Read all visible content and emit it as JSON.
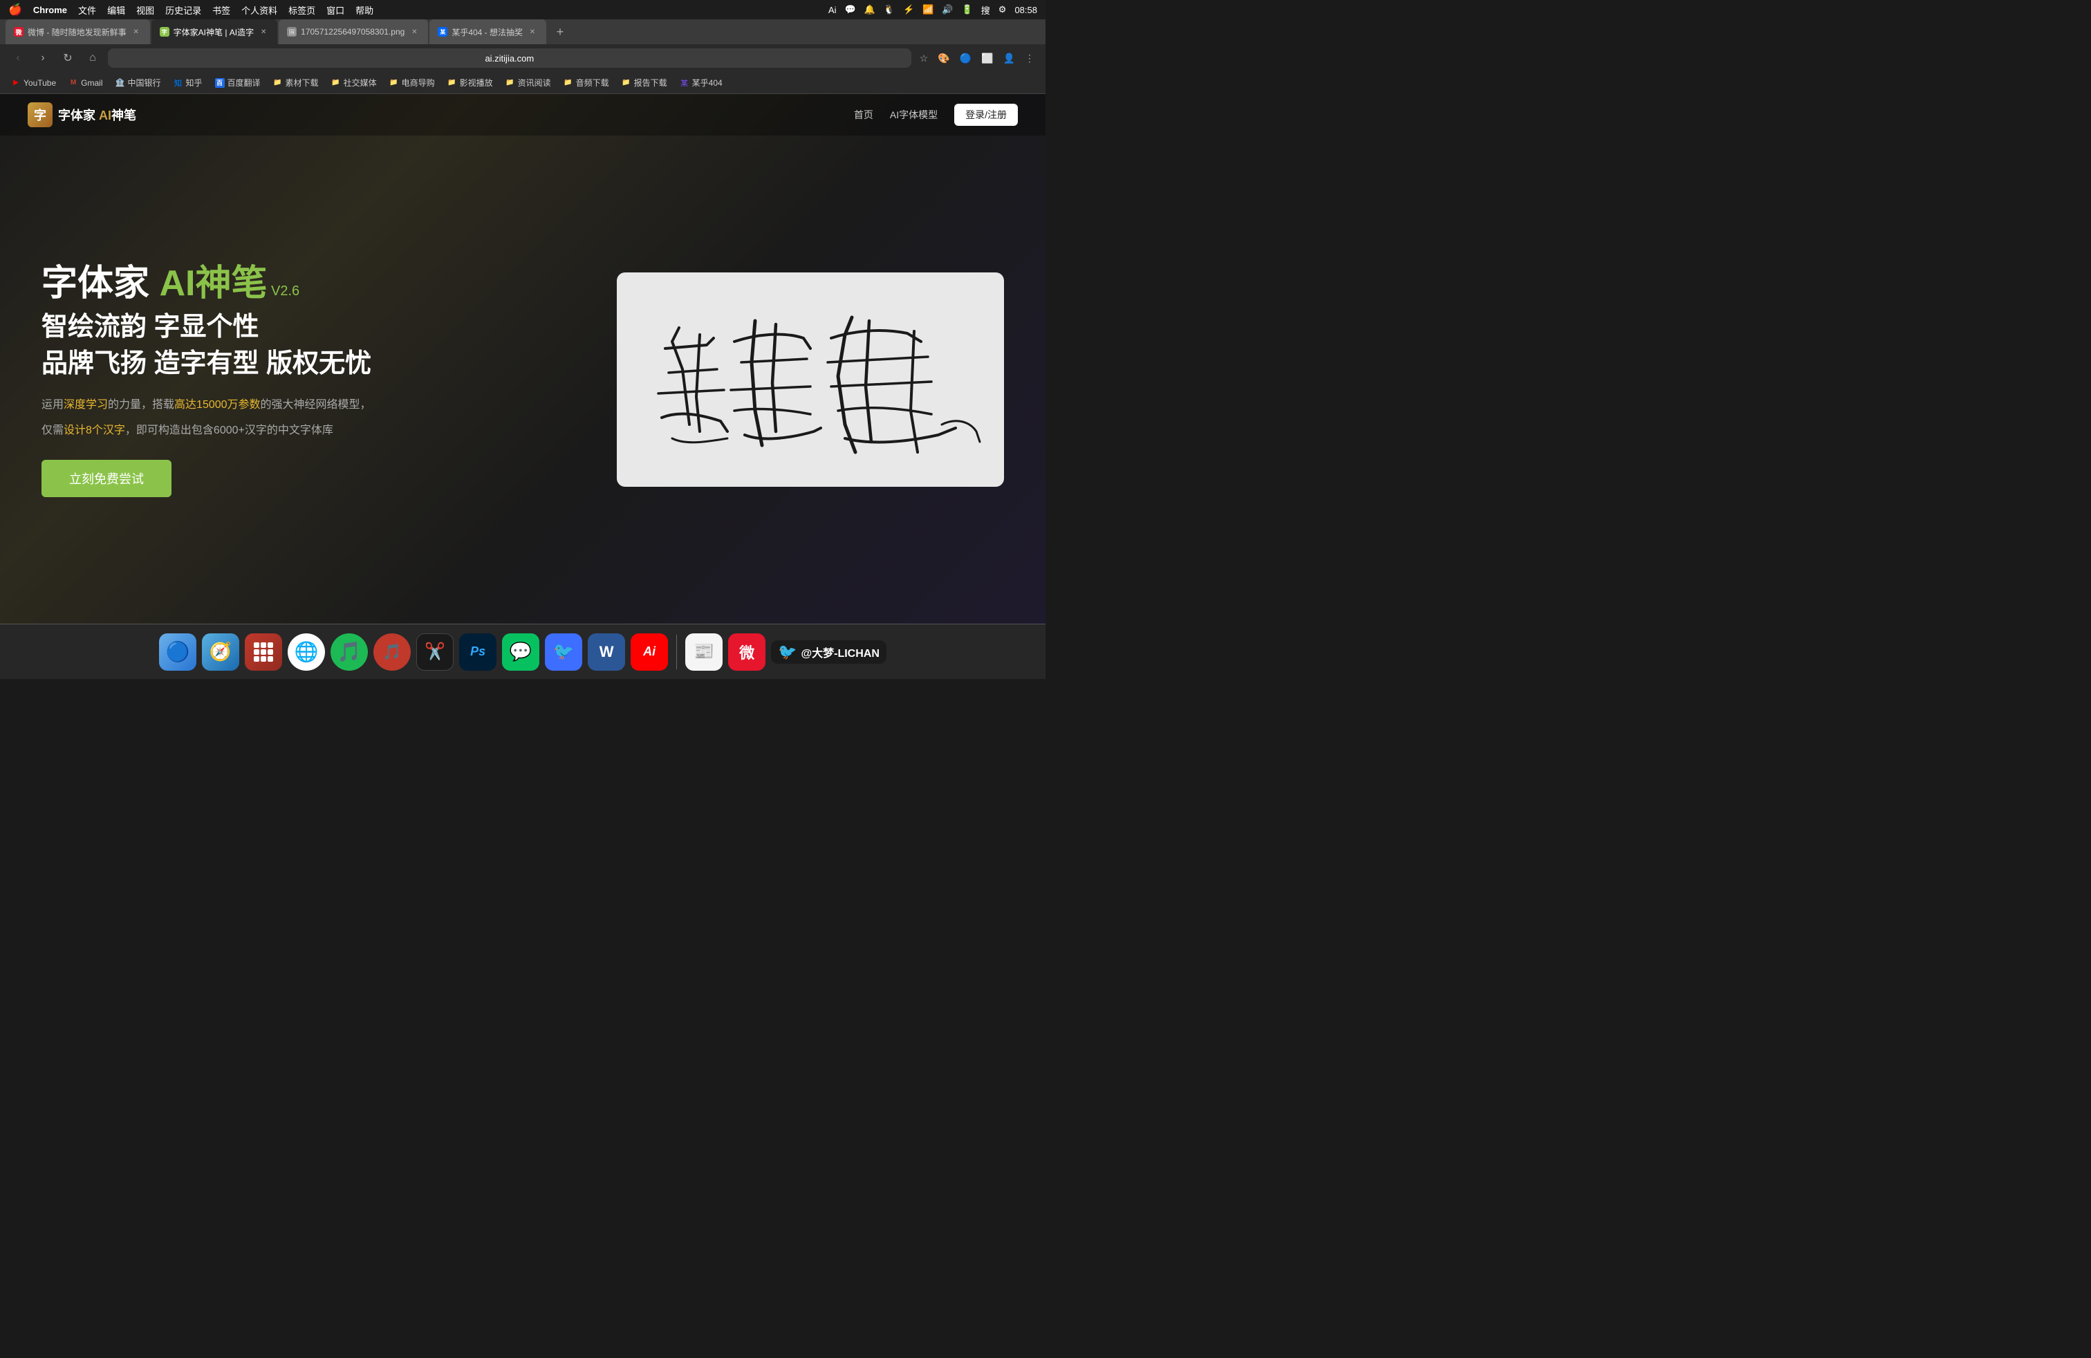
{
  "menubar": {
    "apple": "🍎",
    "items": [
      "Chrome",
      "文件",
      "编辑",
      "视图",
      "历史记录",
      "书签",
      "个人资料",
      "标签页",
      "窗口",
      "帮助"
    ],
    "right_icons": [
      "adobe-icon",
      "wechat-icon",
      "notification-icon",
      "qq-icon",
      "bluetooth-icon",
      "airdrop-icon",
      "volume-icon",
      "play-icon",
      "screentime-icon",
      "sougou-icon",
      "battery-icon",
      "wifi-icon",
      "controlcenter-icon"
    ],
    "time": "08:58"
  },
  "browser": {
    "tabs": [
      {
        "id": "tab1",
        "favicon_color": "#e6162d",
        "title": "微博 - 随时随地发现新鲜事",
        "active": false
      },
      {
        "id": "tab2",
        "favicon_color": "#8bc34a",
        "title": "字体家AI神笔 | AI造字",
        "active": true
      },
      {
        "id": "tab3",
        "favicon_color": "#888",
        "title": "1705712256497058301.png",
        "active": false
      },
      {
        "id": "tab4",
        "favicon_color": "#7c4dff",
        "title": "某乎404 - 想法抽奖",
        "active": false
      }
    ],
    "address": "ai.zitijia.com",
    "bookmarks": [
      {
        "icon": "▶",
        "color": "#ff0000",
        "label": "YouTube"
      },
      {
        "icon": "M",
        "color": "#c44030",
        "label": "Gmail"
      },
      {
        "icon": "🏦",
        "color": "#cc0000",
        "label": "中国银行"
      },
      {
        "icon": "知",
        "color": "#0066cc",
        "label": "知乎"
      },
      {
        "icon": "百",
        "color": "#2060cc",
        "label": "百度翻译"
      },
      {
        "icon": "素",
        "color": "#888",
        "label": "素材下载"
      },
      {
        "icon": "社",
        "color": "#888",
        "label": "社交媒体"
      },
      {
        "icon": "电",
        "color": "#888",
        "label": "电商导购"
      },
      {
        "icon": "影",
        "color": "#888",
        "label": "影视播放"
      },
      {
        "icon": "资",
        "color": "#888",
        "label": "资讯阅读"
      },
      {
        "icon": "音",
        "color": "#888",
        "label": "音频下载"
      },
      {
        "icon": "报",
        "color": "#888",
        "label": "报告下载"
      },
      {
        "icon": "某",
        "color": "#7c4dff",
        "label": "某乎404"
      }
    ]
  },
  "website": {
    "logo_icon": "字",
    "logo_text_part1": "字体家 ",
    "logo_text_ai": "AI",
    "logo_text_pen": "神笔",
    "nav_links": [
      "首页",
      "AI字体模型"
    ],
    "login_btn": "登录/注册",
    "hero": {
      "title_part1": "字体家 ",
      "title_ai": "AI神笔",
      "title_version": " V2.6",
      "subtitle1": "智绘流韵 字显个性",
      "subtitle2": "品牌飞扬 造字有型 版权无忧",
      "desc1_prefix": "运用",
      "desc1_highlight1": "深度学习",
      "desc1_mid": "的力量，搭载",
      "desc1_highlight2": "高达15000万参数",
      "desc1_suffix": "的强大神经网络模型，",
      "desc2_prefix": "仅需",
      "desc2_link": "设计8个汉字",
      "desc2_suffix": "，即可构造出包含6000+汉字的中文字体库",
      "cta_btn": "立刻免费尝试"
    }
  },
  "dock": {
    "items": [
      {
        "name": "finder",
        "emoji": "🔵",
        "label": "Finder"
      },
      {
        "name": "launchpad",
        "emoji": "🚀",
        "label": "Launchpad"
      },
      {
        "name": "launchpad2",
        "emoji": "⊞",
        "label": "App Grid"
      },
      {
        "name": "chrome",
        "emoji": "🌐",
        "label": "Chrome"
      },
      {
        "name": "spotify",
        "emoji": "🎵",
        "label": "Spotify"
      },
      {
        "name": "netease",
        "emoji": "🎵",
        "label": "网易云"
      },
      {
        "name": "finalcut",
        "emoji": "✂️",
        "label": "Final Cut"
      },
      {
        "name": "ps",
        "emoji": "Ps",
        "label": "Photoshop"
      },
      {
        "name": "wechat",
        "emoji": "💬",
        "label": "微信"
      },
      {
        "name": "dingtalk",
        "emoji": "📌",
        "label": "钉钉"
      },
      {
        "name": "word",
        "emoji": "W",
        "label": "Word"
      },
      {
        "name": "adobe",
        "emoji": "Ai",
        "label": "Adobe"
      },
      {
        "name": "newsreader",
        "emoji": "📰",
        "label": "News"
      },
      {
        "name": "weibo-app",
        "emoji": "微",
        "label": "微博"
      }
    ],
    "weibo_section": {
      "text": "@大梦-LICHAN"
    }
  }
}
